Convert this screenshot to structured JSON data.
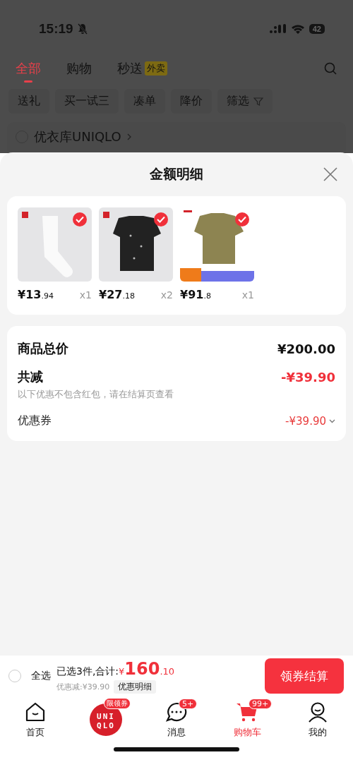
{
  "status_bar": {
    "time": "15:19",
    "battery": "42"
  },
  "top_tabs": [
    {
      "label": "全部",
      "selected": true
    },
    {
      "label": "购物",
      "selected": false
    },
    {
      "label": "秒送",
      "selected": false,
      "badge": "外卖"
    }
  ],
  "filters": [
    {
      "label": "送礼"
    },
    {
      "label": "买一试三"
    },
    {
      "label": "凑单"
    },
    {
      "label": "降价"
    },
    {
      "label": "筛选",
      "kind": "filter"
    }
  ],
  "store": {
    "name": "优衣库UNIQLO",
    "checked": false
  },
  "sheet": {
    "title": "金额明细",
    "products": [
      {
        "price_main": "¥13",
        "price_decimal": ".94",
        "quantity": "x1",
        "checked": true,
        "kind": "sock"
      },
      {
        "price_main": "¥27",
        "price_decimal": ".18",
        "quantity": "x2",
        "checked": true,
        "kind": "top"
      },
      {
        "price_main": "¥91",
        "price_decimal": ".8",
        "quantity": "x1",
        "checked": true,
        "kind": "tee"
      }
    ],
    "summary": {
      "total_label": "商品总价",
      "total_value": "¥200.00",
      "discount_label": "共减",
      "discount_value": "-¥39.90",
      "note": "以下优惠不包含红包，请在结算页查看",
      "coupon_label": "优惠券",
      "coupon_value": "-¥39.90"
    }
  },
  "checkout": {
    "select_all": "全选",
    "checked": false,
    "selected_text": "已选3件,合计:",
    "currency": "¥",
    "total_main": "160",
    "total_decimal": ".10",
    "saved": "优惠减:¥39.90",
    "detail_button": "优惠明细",
    "submit": "领券结算"
  },
  "nav": [
    {
      "label": "首页",
      "kind": "home",
      "selected": false
    },
    {
      "kind": "brand",
      "logo_top": "UNI",
      "logo_bottom": "QLO",
      "badge": "限领券"
    },
    {
      "label": "消息",
      "kind": "message",
      "badge": "5+",
      "selected": false
    },
    {
      "label": "购物车",
      "kind": "cart",
      "badge": "99+",
      "selected": true
    },
    {
      "label": "我的",
      "kind": "profile",
      "selected": false
    }
  ]
}
